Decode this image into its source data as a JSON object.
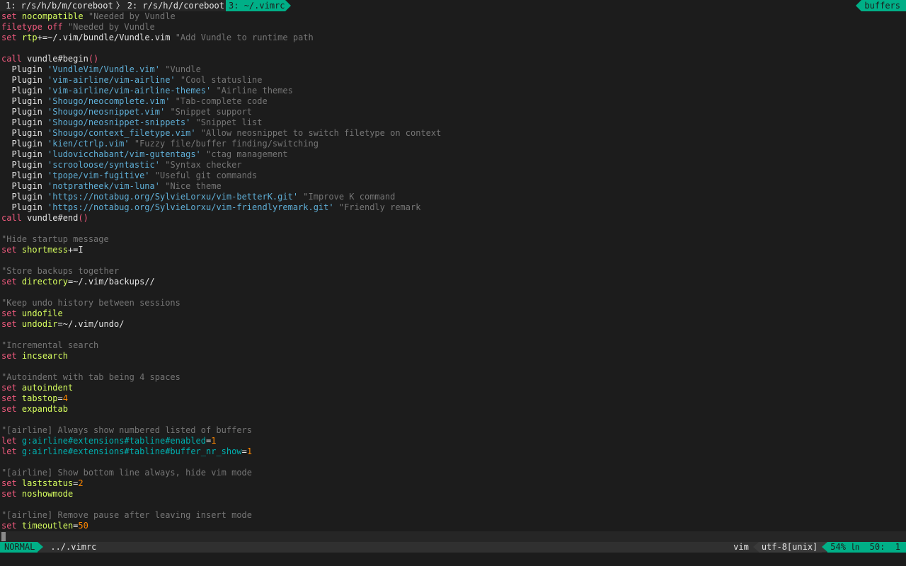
{
  "tabline": {
    "tabs": [
      {
        "label": "1: r/s/h/b/m/coreboot",
        "active": false
      },
      {
        "label": "2: r/s/h/d/coreboot",
        "active": false
      },
      {
        "label": "3: ~/.vimrc",
        "active": true
      }
    ],
    "separator": "〉",
    "right_label": "buffers"
  },
  "lines": [
    [
      [
        "kw",
        "set"
      ],
      [
        "txt",
        " "
      ],
      [
        "opt",
        "nocompatible"
      ],
      [
        "txt",
        " "
      ],
      [
        "cmt",
        "\"Needed by Vundle"
      ]
    ],
    [
      [
        "kw",
        "filetype"
      ],
      [
        "txt",
        " "
      ],
      [
        "kw",
        "off"
      ],
      [
        "txt",
        " "
      ],
      [
        "cmt",
        "\"Needed by Vundle"
      ]
    ],
    [
      [
        "kw",
        "set"
      ],
      [
        "txt",
        " "
      ],
      [
        "opt",
        "rtp"
      ],
      [
        "txt",
        "+=~/.vim/bundle/Vundle.vim "
      ],
      [
        "cmt",
        "\"Add Vundle to runtime path"
      ]
    ],
    [],
    [
      [
        "kw",
        "call"
      ],
      [
        "txt",
        " vundle#begin"
      ],
      [
        "par",
        "()"
      ]
    ],
    [
      [
        "txt",
        "  Plugin "
      ],
      [
        "str",
        "'VundleVim/Vundle.vim'"
      ],
      [
        "txt",
        " "
      ],
      [
        "cmt",
        "\"Vundle"
      ]
    ],
    [
      [
        "txt",
        "  Plugin "
      ],
      [
        "str",
        "'vim-airline/vim-airline'"
      ],
      [
        "txt",
        " "
      ],
      [
        "cmt",
        "\"Cool statusline"
      ]
    ],
    [
      [
        "txt",
        "  Plugin "
      ],
      [
        "str",
        "'vim-airline/vim-airline-themes'"
      ],
      [
        "txt",
        " "
      ],
      [
        "cmt",
        "\"Airline themes"
      ]
    ],
    [
      [
        "txt",
        "  Plugin "
      ],
      [
        "str",
        "'Shougo/neocomplete.vim'"
      ],
      [
        "txt",
        " "
      ],
      [
        "cmt",
        "\"Tab-complete code"
      ]
    ],
    [
      [
        "txt",
        "  Plugin "
      ],
      [
        "str",
        "'Shougo/neosnippet.vim'"
      ],
      [
        "txt",
        " "
      ],
      [
        "cmt",
        "\"Snippet support"
      ]
    ],
    [
      [
        "txt",
        "  Plugin "
      ],
      [
        "str",
        "'Shougo/neosnippet-snippets'"
      ],
      [
        "txt",
        " "
      ],
      [
        "cmt",
        "\"Snippet list"
      ]
    ],
    [
      [
        "txt",
        "  Plugin "
      ],
      [
        "str",
        "'Shougo/context_filetype.vim'"
      ],
      [
        "txt",
        " "
      ],
      [
        "cmt",
        "\"Allow neosnippet to switch filetype on context"
      ]
    ],
    [
      [
        "txt",
        "  Plugin "
      ],
      [
        "str",
        "'kien/ctrlp.vim'"
      ],
      [
        "txt",
        " "
      ],
      [
        "cmt",
        "\"Fuzzy file/buffer finding/switching"
      ]
    ],
    [
      [
        "txt",
        "  Plugin "
      ],
      [
        "str",
        "'ludovicchabant/vim-gutentags'"
      ],
      [
        "txt",
        " "
      ],
      [
        "cmt",
        "\"ctag management"
      ]
    ],
    [
      [
        "txt",
        "  Plugin "
      ],
      [
        "str",
        "'scrooloose/syntastic'"
      ],
      [
        "txt",
        " "
      ],
      [
        "cmt",
        "\"Syntax checker"
      ]
    ],
    [
      [
        "txt",
        "  Plugin "
      ],
      [
        "str",
        "'tpope/vim-fugitive'"
      ],
      [
        "txt",
        " "
      ],
      [
        "cmt",
        "\"Useful git commands"
      ]
    ],
    [
      [
        "txt",
        "  Plugin "
      ],
      [
        "str",
        "'notpratheek/vim-luna'"
      ],
      [
        "txt",
        " "
      ],
      [
        "cmt",
        "\"Nice theme"
      ]
    ],
    [
      [
        "txt",
        "  Plugin "
      ],
      [
        "str",
        "'https://notabug.org/SylvieLorxu/vim-betterK.git'"
      ],
      [
        "txt",
        " "
      ],
      [
        "cmt",
        "\"Improve K command"
      ]
    ],
    [
      [
        "txt",
        "  Plugin "
      ],
      [
        "str",
        "'https://notabug.org/SylvieLorxu/vim-friendlyremark.git'"
      ],
      [
        "txt",
        " "
      ],
      [
        "cmt",
        "\"Friendly remark"
      ]
    ],
    [
      [
        "kw",
        "call"
      ],
      [
        "txt",
        " vundle#end"
      ],
      [
        "par",
        "()"
      ]
    ],
    [],
    [
      [
        "cmt",
        "\"Hide startup message"
      ]
    ],
    [
      [
        "kw",
        "set"
      ],
      [
        "txt",
        " "
      ],
      [
        "opt",
        "shortmess"
      ],
      [
        "txt",
        "+=I"
      ]
    ],
    [],
    [
      [
        "cmt",
        "\"Store backups together"
      ]
    ],
    [
      [
        "kw",
        "set"
      ],
      [
        "txt",
        " "
      ],
      [
        "opt",
        "directory"
      ],
      [
        "txt",
        "=~/.vim/backups//"
      ]
    ],
    [],
    [
      [
        "cmt",
        "\"Keep undo history between sessions"
      ]
    ],
    [
      [
        "kw",
        "set"
      ],
      [
        "txt",
        " "
      ],
      [
        "opt",
        "undofile"
      ]
    ],
    [
      [
        "kw",
        "set"
      ],
      [
        "txt",
        " "
      ],
      [
        "opt",
        "undodir"
      ],
      [
        "txt",
        "=~/.vim/undo/"
      ]
    ],
    [],
    [
      [
        "cmt",
        "\"Incremental search"
      ]
    ],
    [
      [
        "kw",
        "set"
      ],
      [
        "txt",
        " "
      ],
      [
        "opt",
        "incsearch"
      ]
    ],
    [],
    [
      [
        "cmt",
        "\"Autoindent with tab being 4 spaces"
      ]
    ],
    [
      [
        "kw",
        "set"
      ],
      [
        "txt",
        " "
      ],
      [
        "opt",
        "autoindent"
      ]
    ],
    [
      [
        "kw",
        "set"
      ],
      [
        "txt",
        " "
      ],
      [
        "opt",
        "tabstop"
      ],
      [
        "txt",
        "="
      ],
      [
        "num",
        "4"
      ]
    ],
    [
      [
        "kw",
        "set"
      ],
      [
        "txt",
        " "
      ],
      [
        "opt",
        "expandtab"
      ]
    ],
    [],
    [
      [
        "cmt",
        "\"[airline] Always show numbered listed of buffers"
      ]
    ],
    [
      [
        "kw",
        "let"
      ],
      [
        "txt",
        " "
      ],
      [
        "var",
        "g:airline#extensions#tabline#enabled"
      ],
      [
        "txt",
        "="
      ],
      [
        "num",
        "1"
      ]
    ],
    [
      [
        "kw",
        "let"
      ],
      [
        "txt",
        " "
      ],
      [
        "var",
        "g:airline#extensions#tabline#buffer_nr_show"
      ],
      [
        "txt",
        "="
      ],
      [
        "num",
        "1"
      ]
    ],
    [],
    [
      [
        "cmt",
        "\"[airline] Show bottom line always, hide vim mode"
      ]
    ],
    [
      [
        "kw",
        "set"
      ],
      [
        "txt",
        " "
      ],
      [
        "opt",
        "laststatus"
      ],
      [
        "txt",
        "="
      ],
      [
        "num",
        "2"
      ]
    ],
    [
      [
        "kw",
        "set"
      ],
      [
        "txt",
        " "
      ],
      [
        "opt",
        "noshowmode"
      ]
    ],
    [],
    [
      [
        "cmt",
        "\"[airline] Remove pause after leaving insert mode"
      ]
    ],
    [
      [
        "kw",
        "set"
      ],
      [
        "txt",
        " "
      ],
      [
        "opt",
        "timeoutlen"
      ],
      [
        "txt",
        "="
      ],
      [
        "num",
        "50"
      ]
    ]
  ],
  "statusline": {
    "mode": "NORMAL",
    "filename": "../.vimrc",
    "filetype": "vim",
    "encoding": "utf-8[unix]",
    "position": "54% ㏑  50:  1"
  },
  "colors": {
    "background": "#1c1c1c",
    "accent": "#00af87",
    "keyword": "#f05a7e",
    "option": "#d7ff5f",
    "string": "#5fafd7",
    "comment": "#767676"
  }
}
